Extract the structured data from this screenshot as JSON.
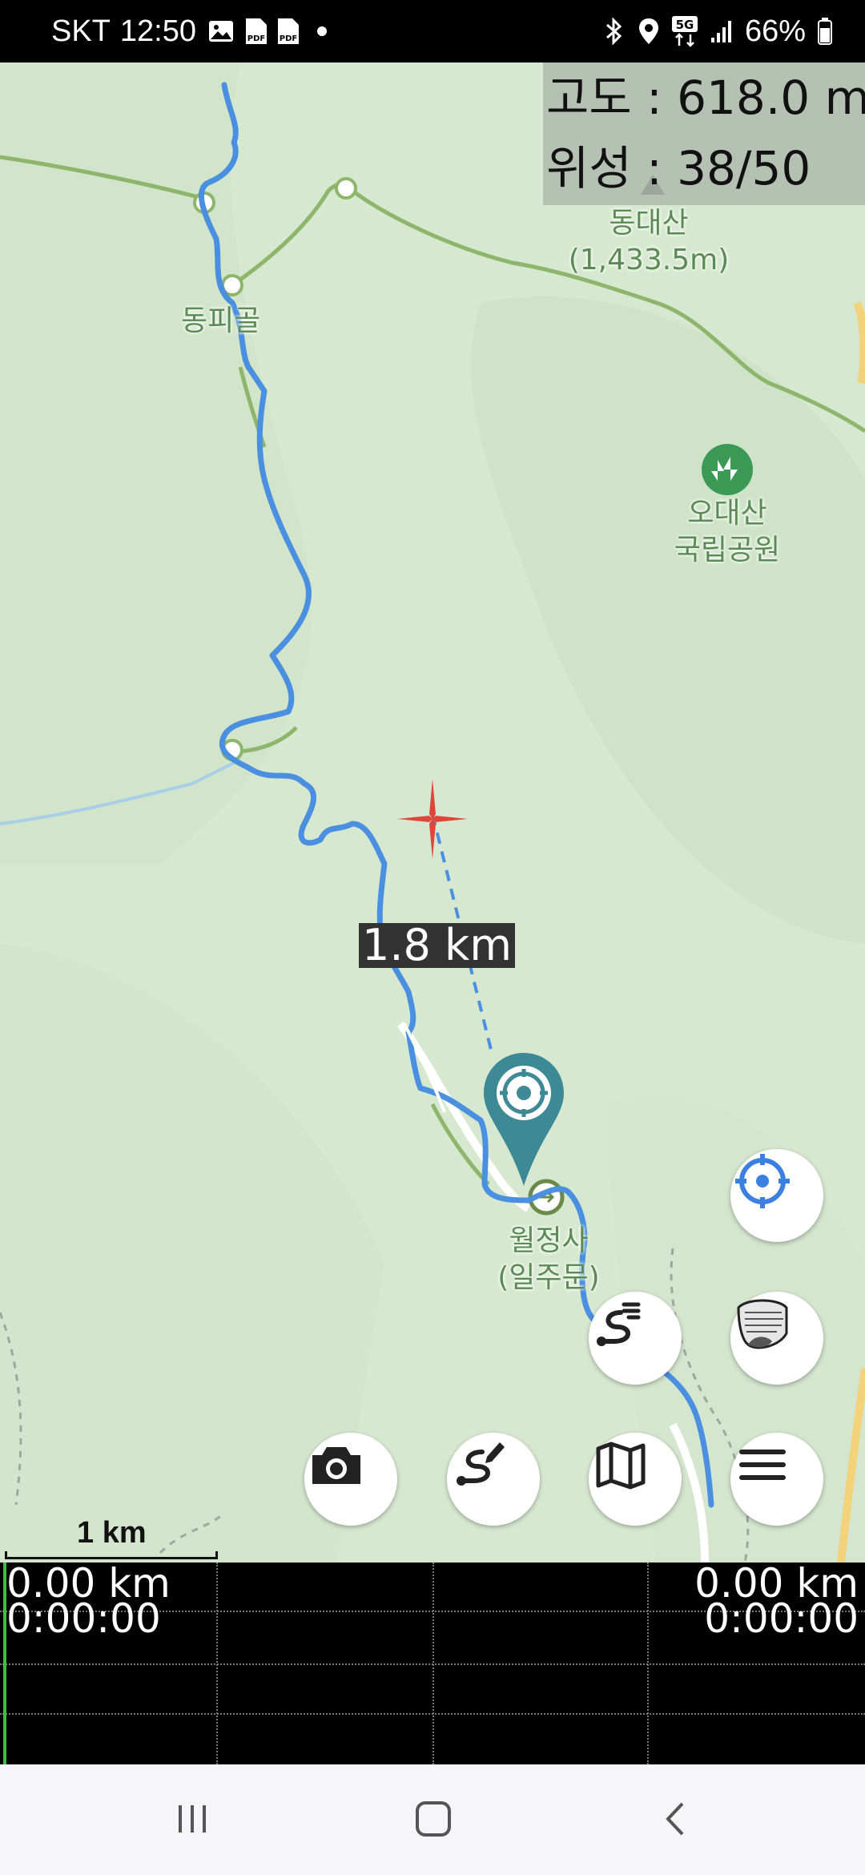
{
  "status_bar": {
    "carrier": "SKT",
    "time": "12:50",
    "battery": "66%",
    "icons": [
      "image-icon",
      "pdf-icon",
      "pdf-icon",
      "dot-icon",
      "bluetooth-icon",
      "location-icon",
      "5g-icon",
      "signal-icon",
      "battery-icon"
    ]
  },
  "info_panel": {
    "altitude": "고도 : 618.0 m",
    "satellites": "위성 : 38/50"
  },
  "map": {
    "labels": {
      "dongpigol": "동피골",
      "dongdaesan_name": "동대산",
      "dongdaesan_height": "(1,433.5m)",
      "park_line1": "오대산",
      "park_line2": "국립공원",
      "woljeongsa_line1": "월정사",
      "woljeongsa_line2": "(일주문)"
    },
    "distance_label": "1.8 km",
    "scale": "1 km",
    "route_color": "#4a8fe0",
    "trail_color": "#8db56b",
    "marker_color": "#3d8a96",
    "crosshair_color": "#e0443a"
  },
  "buttons": {
    "locate": "crosshair-icon",
    "layer": "layer-icon",
    "route_list": "route-list-icon",
    "camera": "camera-icon",
    "route_edit": "route-edit-icon",
    "map": "map-icon",
    "menu": "menu-icon"
  },
  "track_panel": {
    "left_distance": "0.00 km",
    "left_time": "0:00:00",
    "right_distance": "0.00 km",
    "right_time": "0:00:00"
  }
}
